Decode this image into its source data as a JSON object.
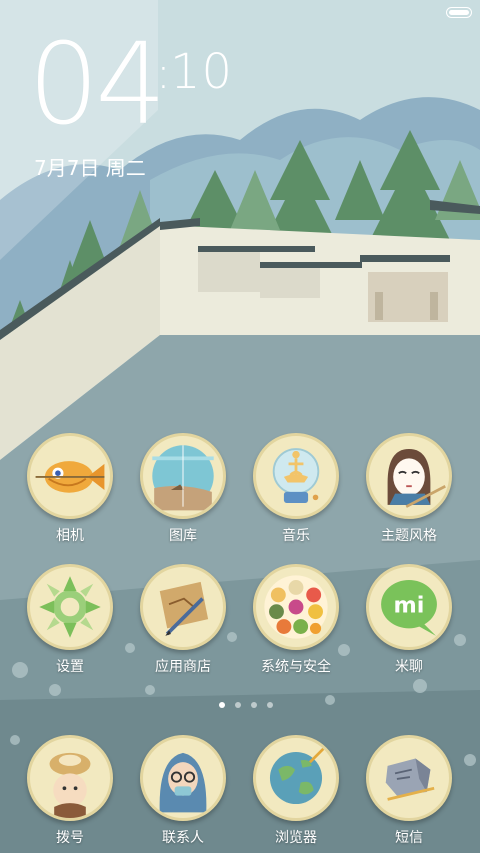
{
  "clock": {
    "hours": "04",
    "minutes": "10",
    "date": "7月7日 周二"
  },
  "apps": [
    {
      "name": "camera",
      "label": "相机"
    },
    {
      "name": "gallery",
      "label": "图库"
    },
    {
      "name": "music",
      "label": "音乐"
    },
    {
      "name": "themes",
      "label": "主题风格"
    },
    {
      "name": "settings",
      "label": "设置"
    },
    {
      "name": "app-store",
      "label": "应用商店"
    },
    {
      "name": "security",
      "label": "系统与安全"
    },
    {
      "name": "mitalk",
      "label": "米聊"
    },
    {
      "name": "dialer",
      "label": "拨号"
    },
    {
      "name": "contacts",
      "label": "联系人"
    },
    {
      "name": "browser",
      "label": "浏览器"
    },
    {
      "name": "messages",
      "label": "短信"
    }
  ],
  "icons": {
    "camera": "fish-icon",
    "gallery": "sea-window-icon",
    "music": "ballerina-music-box-icon",
    "themes": "masked-character-icon",
    "settings": "bamboo-gear-icon",
    "app-store": "map-pen-icon",
    "security": "toolbox-grid-icon",
    "mitalk": "mi-chat-bubble-icon",
    "dialer": "bird-nest-head-icon",
    "contacts": "hooded-person-icon",
    "browser": "globe-icon",
    "messages": "stone-letter-icon"
  },
  "page_indicator": {
    "count": 4,
    "current": 1
  },
  "battery": {
    "level": 1.0
  }
}
